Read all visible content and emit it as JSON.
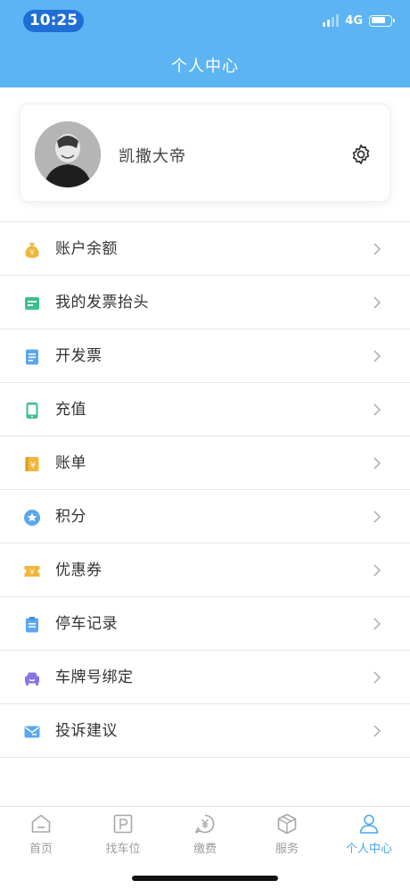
{
  "status_bar": {
    "time": "10:25",
    "network": "4G"
  },
  "header": {
    "title": "个人中心"
  },
  "profile": {
    "name": "凯撒大帝"
  },
  "menu": [
    {
      "label": "账户余额",
      "icon": "money-bag-icon",
      "color": "#f2b63a"
    },
    {
      "label": "我的发票抬头",
      "icon": "invoice-header-icon",
      "color": "#3bbf8c"
    },
    {
      "label": "开发票",
      "icon": "invoice-document-icon",
      "color": "#5aa7ef"
    },
    {
      "label": "充值",
      "icon": "phone-recharge-icon",
      "color": "#3bbf8c"
    },
    {
      "label": "账单",
      "icon": "bill-book-icon",
      "color": "#f2b63a"
    },
    {
      "label": "积分",
      "icon": "star-points-icon",
      "color": "#5aa7ef"
    },
    {
      "label": "优惠券",
      "icon": "coupon-icon",
      "color": "#f2b63a"
    },
    {
      "label": "停车记录",
      "icon": "clipboard-icon",
      "color": "#5aa7ef"
    },
    {
      "label": "车牌号绑定",
      "icon": "car-plate-icon",
      "color": "#8a72e8"
    },
    {
      "label": "投诉建议",
      "icon": "envelope-icon",
      "color": "#5aa7ef"
    }
  ],
  "tabbar": {
    "tabs": [
      {
        "label": "首页",
        "icon": "home-icon",
        "active": false
      },
      {
        "label": "找车位",
        "icon": "parking-icon",
        "active": false
      },
      {
        "label": "缴费",
        "icon": "payment-icon",
        "active": false
      },
      {
        "label": "服务",
        "icon": "service-box-icon",
        "active": false
      },
      {
        "label": "个人中心",
        "icon": "person-icon",
        "active": true
      }
    ]
  },
  "colors": {
    "header_bg": "#5cb4f2",
    "active_tab": "#47a8ef",
    "inactive_tab": "#9b9b9b",
    "time_pill": "#1f6ed6"
  }
}
